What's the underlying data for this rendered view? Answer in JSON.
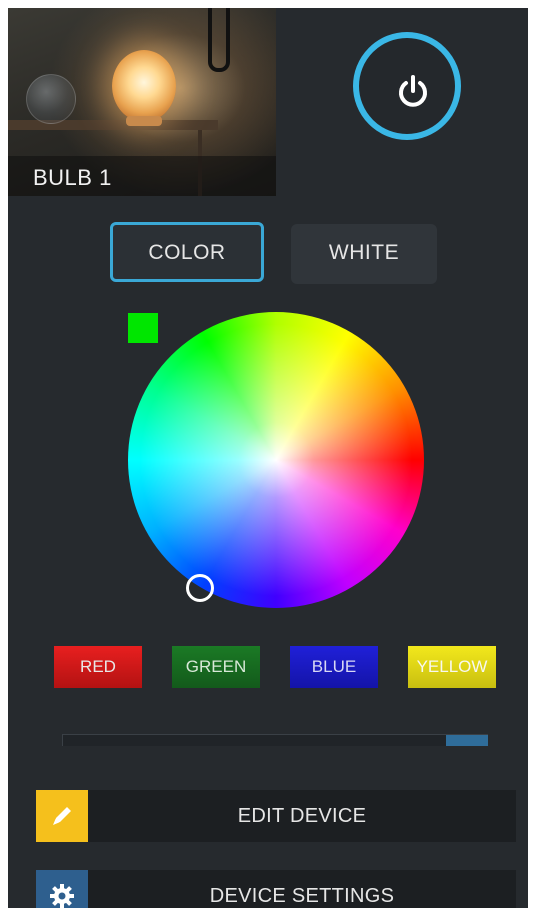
{
  "device": {
    "name": "BULB 1",
    "power_icon": "power-icon"
  },
  "mode_tabs": {
    "color_label": "COLOR",
    "white_label": "WHITE",
    "selected": "COLOR"
  },
  "selected_color": "#00e600",
  "presets": [
    {
      "label": "RED",
      "color": "#e81f1f"
    },
    {
      "label": "GREEN",
      "color": "#1b7a25"
    },
    {
      "label": "BLUE",
      "color": "#2020d8"
    },
    {
      "label": "YELLOW",
      "color": "#f2e81c"
    }
  ],
  "brightness_slider": {
    "value_fraction": 0.9
  },
  "actions": {
    "edit_label": "EDIT DEVICE",
    "edit_icon": "pencil-icon",
    "settings_label": "DEVICE SETTINGS",
    "settings_icon": "gear-icon"
  },
  "colors": {
    "accent": "#3ab7e6",
    "background": "#262a2e",
    "edit_icon_bg": "#f5c01c",
    "settings_icon_bg": "#2e5f8e"
  }
}
